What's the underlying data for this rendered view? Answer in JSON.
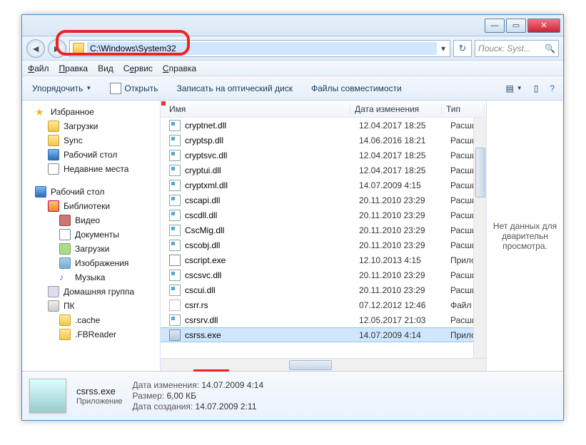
{
  "address": {
    "path": "C:\\Windows\\System32",
    "search_placeholder": "Поиск: Syst..."
  },
  "menu": {
    "file": "Файл",
    "edit": "Правка",
    "view": "Вид",
    "tools": "Сервис",
    "help": "Справка"
  },
  "toolbar": {
    "organize": "Упорядочить",
    "open": "Открыть",
    "burn": "Записать на оптический диск",
    "compat": "Файлы совместимости"
  },
  "nav": {
    "favorites": "Избранное",
    "fav_items": [
      "Загрузки",
      "Sync",
      "Рабочий стол",
      "Недавние места"
    ],
    "desktop": "Рабочий стол",
    "libraries": "Библиотеки",
    "lib_items": [
      "Видео",
      "Документы",
      "Загрузки",
      "Изображения",
      "Музыка"
    ],
    "homegroup": "Домашняя группа",
    "pc": "ПК",
    "pc_items": [
      ".cache",
      ".FBReader"
    ]
  },
  "columns": {
    "name": "Имя",
    "date": "Дата изменения",
    "type": "Тип"
  },
  "files": [
    {
      "name": "cryptnet.dll",
      "date": "12.04.2017 18:25",
      "type": "Расши",
      "icon": "dll"
    },
    {
      "name": "cryptsp.dll",
      "date": "14.06.2016 18:21",
      "type": "Расши",
      "icon": "dll"
    },
    {
      "name": "cryptsvc.dll",
      "date": "12.04.2017 18:25",
      "type": "Расши",
      "icon": "dll"
    },
    {
      "name": "cryptui.dll",
      "date": "12.04.2017 18:25",
      "type": "Расши",
      "icon": "dll"
    },
    {
      "name": "cryptxml.dll",
      "date": "14.07.2009 4:15",
      "type": "Расши",
      "icon": "dll"
    },
    {
      "name": "cscapi.dll",
      "date": "20.11.2010 23:29",
      "type": "Расши",
      "icon": "dll"
    },
    {
      "name": "cscdll.dll",
      "date": "20.11.2010 23:29",
      "type": "Расши",
      "icon": "dll"
    },
    {
      "name": "CscMig.dll",
      "date": "20.11.2010 23:29",
      "type": "Расши",
      "icon": "dll"
    },
    {
      "name": "cscobj.dll",
      "date": "20.11.2010 23:29",
      "type": "Расши",
      "icon": "dll"
    },
    {
      "name": "cscript.exe",
      "date": "12.10.2013 4:15",
      "type": "Прило",
      "icon": "cscript"
    },
    {
      "name": "cscsvc.dll",
      "date": "20.11.2010 23:29",
      "type": "Расши",
      "icon": "dll"
    },
    {
      "name": "cscui.dll",
      "date": "20.11.2010 23:29",
      "type": "Расши",
      "icon": "dll"
    },
    {
      "name": "csrr.rs",
      "date": "07.12.2012 12:46",
      "type": "Файл \"",
      "icon": "rs"
    },
    {
      "name": "csrsrv.dll",
      "date": "12.05.2017 21:03",
      "type": "Расши",
      "icon": "dll"
    },
    {
      "name": "csrss.exe",
      "date": "14.07.2009 4:14",
      "type": "Прило",
      "icon": "exe",
      "selected": true
    }
  ],
  "preview": {
    "empty": "Нет данных для дварительн просмотра."
  },
  "details": {
    "filename": "csrss.exe",
    "filetype": "Приложение",
    "modified_label": "Дата изменения:",
    "modified": "14.07.2009 4:14",
    "size_label": "Размер:",
    "size": "6,00 КБ",
    "created_label": "Дата создания:",
    "created": "14.07.2009 2:11"
  }
}
